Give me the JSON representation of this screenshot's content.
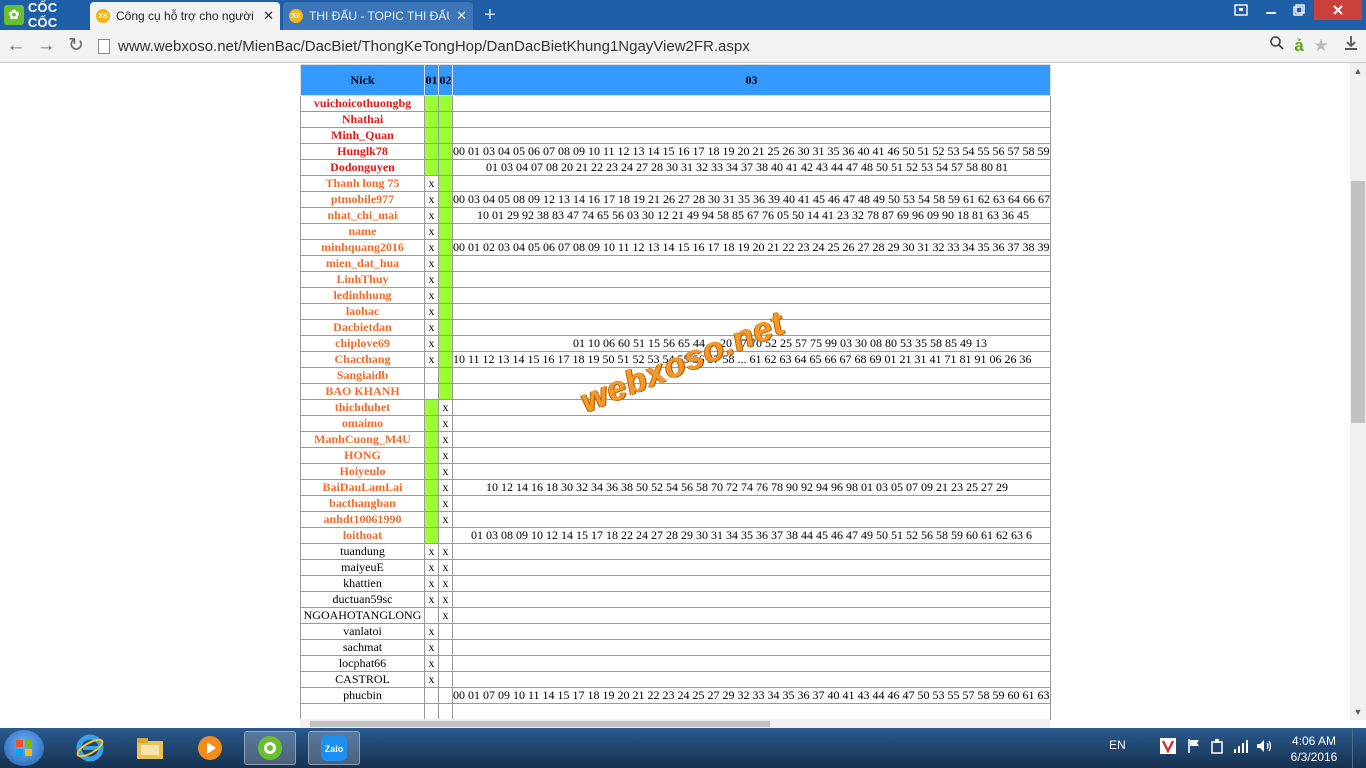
{
  "browser": {
    "logo_text": "CỐC CỐC",
    "tabs": [
      {
        "title": "Công cụ hỗ trợ cho người",
        "favicon": "XS",
        "active": true
      },
      {
        "title": "THI ĐẤU - TOPIC THI ĐẤU",
        "favicon": "XS",
        "active": false
      }
    ],
    "url": "www.webxoso.net/MienBac/DacBiet/ThongKeTongHop/DanDacBietKhung1NgayView2FR.aspx"
  },
  "table": {
    "headers": [
      "Nick",
      "01",
      "02",
      "03"
    ],
    "rows": [
      {
        "nick": "vuichoicothuongbg",
        "color": "#e21a1a",
        "bold": true,
        "c01": "",
        "c02": "",
        "g01": true,
        "g02": true,
        "nums": ""
      },
      {
        "nick": "Nhathai",
        "color": "#e21a1a",
        "bold": true,
        "c01": "",
        "c02": "",
        "g01": true,
        "g02": true,
        "nums": ""
      },
      {
        "nick": "Minh_Quan",
        "color": "#e21a1a",
        "bold": true,
        "c01": "",
        "c02": "",
        "g01": true,
        "g02": true,
        "nums": ""
      },
      {
        "nick": "Hunglk78",
        "color": "#e21a1a",
        "bold": true,
        "c01": "",
        "c02": "",
        "g01": true,
        "g02": true,
        "nums": "00 01 03 04 05 06 07 08 09 10 11 12 13 14 15 16 17 18 19 20 21 25 26 30 31 35 36 40 41 46 50 51 52 53 54 55 56 57 58 59"
      },
      {
        "nick": "Dodonguyen",
        "color": "#e21a1a",
        "bold": true,
        "c01": "",
        "c02": "",
        "g01": true,
        "g02": true,
        "nums": "           01 03 04 07 08 20 21 22 23 24 27 28 30 31 32 33 34 37 38 40 41 42 43 44 47 48 50 51 52 53 54 57 58 80 81"
      },
      {
        "nick": "Thanh long 75",
        "color": "#ef6c2c",
        "bold": true,
        "c01": "x",
        "c02": "",
        "g01": false,
        "g02": true,
        "nums": ""
      },
      {
        "nick": "ptmobile977",
        "color": "#ef6c2c",
        "bold": true,
        "c01": "x",
        "c02": "",
        "g01": false,
        "g02": true,
        "nums": "00 03 04 05 08 09 12 13 14 16 17 18 19 21 26 27 28 30 31 35 36 39 40 41 45 46 47 48 49 50 53 54 58 59 61 62 63 64 66 67"
      },
      {
        "nick": "nhat_chi_mai",
        "color": "#ef6c2c",
        "bold": true,
        "c01": "x",
        "c02": "",
        "g01": false,
        "g02": true,
        "nums": "        10 01 29 92 38 83 47 74 65 56 03 30 12 21 49 94 58 85 67 76 05 50 14 41 23 32 78 87 69 96 09 90 18 81 63 36 45"
      },
      {
        "nick": "name",
        "color": "#ef6c2c",
        "bold": true,
        "c01": "x",
        "c02": "",
        "g01": false,
        "g02": true,
        "nums": ""
      },
      {
        "nick": "minhquang2016",
        "color": "#ef6c2c",
        "bold": true,
        "c01": "x",
        "c02": "",
        "g01": false,
        "g02": true,
        "nums": "00 01 02 03 04 05 06 07 08 09 10 11 12 13 14 15 16 17 18 19 20 21 22 23 24 25 26 27 28 29 30 31 32 33 34 35 36 37 38 39"
      },
      {
        "nick": "mien_dat_hua",
        "color": "#ef6c2c",
        "bold": true,
        "c01": "x",
        "c02": "",
        "g01": false,
        "g02": true,
        "nums": ""
      },
      {
        "nick": "LinhThuy",
        "color": "#ef6c2c",
        "bold": true,
        "c01": "x",
        "c02": "",
        "g01": false,
        "g02": true,
        "nums": ""
      },
      {
        "nick": "ledinhhung",
        "color": "#ef6c2c",
        "bold": true,
        "c01": "x",
        "c02": "",
        "g01": false,
        "g02": true,
        "nums": ""
      },
      {
        "nick": "laohac",
        "color": "#ef6c2c",
        "bold": true,
        "c01": "x",
        "c02": "",
        "g01": false,
        "g02": true,
        "nums": ""
      },
      {
        "nick": "Dacbietdan",
        "color": "#ef6c2c",
        "bold": true,
        "c01": "x",
        "c02": "",
        "g01": false,
        "g02": true,
        "nums": ""
      },
      {
        "nick": "chiplove69",
        "color": "#ef6c2c",
        "bold": true,
        "c01": "x",
        "c02": "",
        "g01": false,
        "g02": true,
        "nums": "                                        01 10 06 60 51 15 56 65 44 ... 20 07 70 52 25 57 75 99 03 30 08 80 53 35 58 85 49 13"
      },
      {
        "nick": "Chacthang",
        "color": "#ef6c2c",
        "bold": true,
        "c01": "x",
        "c02": "",
        "g01": false,
        "g02": true,
        "nums": "10 11 12 13 14 15 16 17 18 19 50 51 52 53 54 55 56 57 58 ... 61 62 63 64 65 66 67 68 69 01 21 31 41 71 81 91 06 26 36"
      },
      {
        "nick": "Sangiaidb",
        "color": "#ef6c2c",
        "bold": true,
        "c01": "",
        "c02": "",
        "g01": false,
        "g02": true,
        "nums": ""
      },
      {
        "nick": "BAO KHANH",
        "color": "#ef6c2c",
        "bold": true,
        "c01": "",
        "c02": "",
        "g01": false,
        "g02": true,
        "nums": ""
      },
      {
        "nick": "thichduhet",
        "color": "#ef6c2c",
        "bold": true,
        "c01": "",
        "c02": "x",
        "g01": true,
        "g02": false,
        "nums": ""
      },
      {
        "nick": "omaimo",
        "color": "#ef6c2c",
        "bold": true,
        "c01": "",
        "c02": "x",
        "g01": true,
        "g02": false,
        "nums": ""
      },
      {
        "nick": "ManhCuong_M4U",
        "color": "#ef6c2c",
        "bold": true,
        "c01": "",
        "c02": "x",
        "g01": true,
        "g02": false,
        "nums": ""
      },
      {
        "nick": "HONG",
        "color": "#ef6c2c",
        "bold": true,
        "c01": "",
        "c02": "x",
        "g01": true,
        "g02": false,
        "nums": ""
      },
      {
        "nick": "Hoiyeulo",
        "color": "#ef6c2c",
        "bold": true,
        "c01": "",
        "c02": "x",
        "g01": true,
        "g02": false,
        "nums": ""
      },
      {
        "nick": "BaiDauLamLai",
        "color": "#ef6c2c",
        "bold": true,
        "c01": "",
        "c02": "x",
        "g01": true,
        "g02": false,
        "nums": "           10 12 14 16 18 30 32 34 36 38 50 52 54 56 58 70 72 74 76 78 90 92 94 96 98 01 03 05 07 09 21 23 25 27 29"
      },
      {
        "nick": "bacthangban",
        "color": "#ef6c2c",
        "bold": true,
        "c01": "",
        "c02": "x",
        "g01": true,
        "g02": false,
        "nums": ""
      },
      {
        "nick": "anhdt10061990",
        "color": "#ef6c2c",
        "bold": true,
        "c01": "",
        "c02": "x",
        "g01": true,
        "g02": false,
        "nums": ""
      },
      {
        "nick": "loithoat",
        "color": "#ef6c2c",
        "bold": true,
        "c01": "",
        "c02": "",
        "g01": true,
        "g02": false,
        "nums": "      01 03 08 09 10 12 14 15 17 18 22 24 27 28 29 30 31 34 35 36 37 38 44 45 46 47 49 50 51 52 56 58 59 60 61 62 63 6"
      },
      {
        "nick": "tuandung",
        "color": "#000000",
        "bold": false,
        "c01": "x",
        "c02": "x",
        "g01": false,
        "g02": false,
        "nums": ""
      },
      {
        "nick": "maiyeuE",
        "color": "#000000",
        "bold": false,
        "c01": "x",
        "c02": "x",
        "g01": false,
        "g02": false,
        "nums": ""
      },
      {
        "nick": "khattien",
        "color": "#000000",
        "bold": false,
        "c01": "x",
        "c02": "x",
        "g01": false,
        "g02": false,
        "nums": ""
      },
      {
        "nick": "ductuan59sc",
        "color": "#000000",
        "bold": false,
        "c01": "x",
        "c02": "x",
        "g01": false,
        "g02": false,
        "nums": ""
      },
      {
        "nick": "NGOAHOTANGLONG",
        "color": "#000000",
        "bold": false,
        "c01": "",
        "c02": "x",
        "g01": false,
        "g02": false,
        "nums": ""
      },
      {
        "nick": "vanlatoi",
        "color": "#000000",
        "bold": false,
        "c01": "x",
        "c02": "",
        "g01": false,
        "g02": false,
        "nums": ""
      },
      {
        "nick": "sachmat",
        "color": "#000000",
        "bold": false,
        "c01": "x",
        "c02": "",
        "g01": false,
        "g02": false,
        "nums": ""
      },
      {
        "nick": "locphat66",
        "color": "#000000",
        "bold": false,
        "c01": "x",
        "c02": "",
        "g01": false,
        "g02": false,
        "nums": ""
      },
      {
        "nick": "CASTROL",
        "color": "#000000",
        "bold": false,
        "c01": "x",
        "c02": "",
        "g01": false,
        "g02": false,
        "nums": ""
      },
      {
        "nick": "phucbin",
        "color": "#000000",
        "bold": false,
        "c01": "",
        "c02": "",
        "g01": false,
        "g02": false,
        "nums": "00 01 07 09 10 11 14 15 17 18 19 20 21 22 23 24 25 27 29 32 33 34 35 36 37 40 41 43 44 46 47 50 53 55 57 58 59 60 61 63"
      },
      {
        "nick": "",
        "color": "#000000",
        "bold": false,
        "c01": "",
        "c02": "",
        "g01": false,
        "g02": false,
        "nums": ""
      }
    ]
  },
  "watermark": "webxoso.net",
  "taskbar": {
    "lang": "EN",
    "time": "4:06 AM",
    "date": "6/3/2016"
  },
  "colors": {
    "header_bg": "#3399ff",
    "green_cell": "#99ff33",
    "nick_red": "#e21a1a",
    "nick_orange": "#ef6c2c",
    "tabbar": "#1f5fa8"
  }
}
